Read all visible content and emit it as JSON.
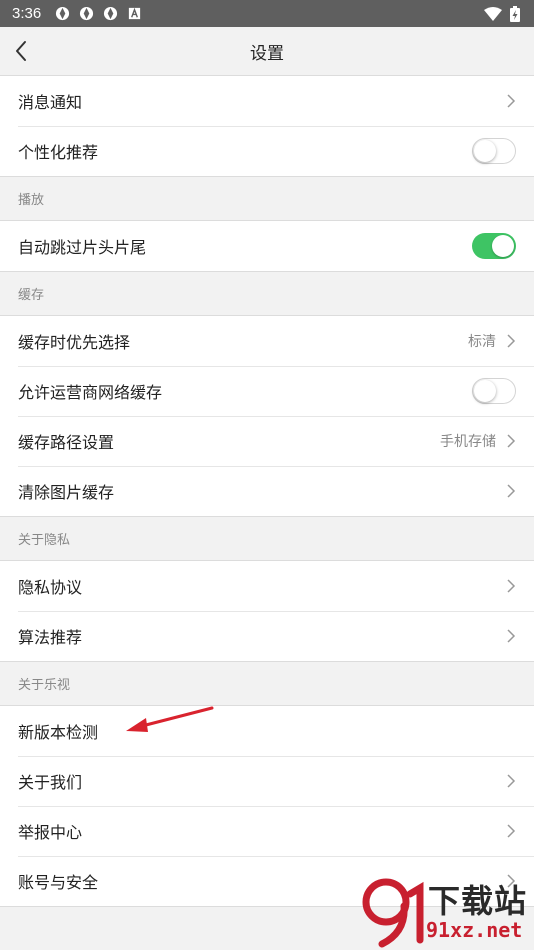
{
  "status_bar": {
    "time": "3:36"
  },
  "header": {
    "title": "设置"
  },
  "group1": {
    "notifications": "消息通知",
    "personalized": "个性化推荐",
    "personalized_on": false
  },
  "playback": {
    "header": "播放",
    "skip": "自动跳过片头片尾",
    "skip_on": true
  },
  "cache": {
    "header": "缓存",
    "priority": "缓存时优先选择",
    "priority_value": "标清",
    "carrier": "允许运营商网络缓存",
    "carrier_on": false,
    "path": "缓存路径设置",
    "path_value": "手机存储",
    "clear": "清除图片缓存"
  },
  "privacy": {
    "header": "关于隐私",
    "policy": "隐私协议",
    "algorithm": "算法推荐"
  },
  "about": {
    "header": "关于乐视",
    "update": "新版本检测",
    "about_us": "关于我们",
    "report": "举报中心",
    "account": "账号与安全"
  },
  "watermark": {
    "text": "下载站",
    "url": "91xz.net"
  },
  "colors": {
    "toggle_on": "#3ec464",
    "annotation": "#d9232e"
  }
}
